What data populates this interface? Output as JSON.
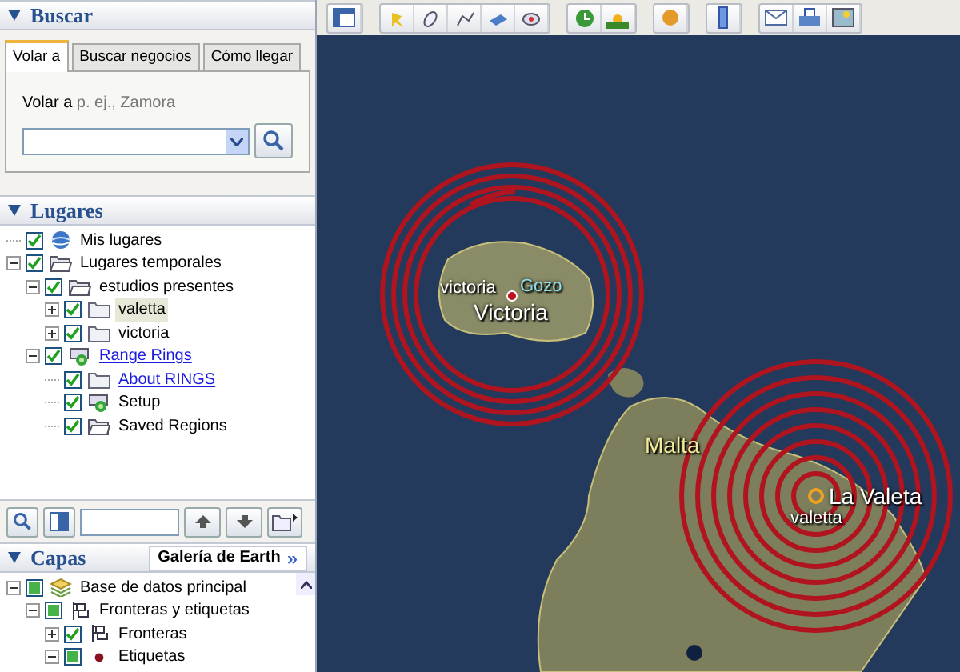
{
  "search": {
    "title": "Buscar",
    "expanded": true,
    "tabs": [
      {
        "label": "Volar a",
        "selected": true
      },
      {
        "label": "Buscar negocios",
        "selected": false
      },
      {
        "label": "Cómo llegar",
        "selected": false
      }
    ],
    "prompt": "Volar a",
    "placeholder": "p. ej., Zamora"
  },
  "places": {
    "title": "Lugares",
    "expanded": true,
    "tree": [
      {
        "label": "Mis lugares",
        "kind": "globe",
        "checked": true,
        "link": false,
        "selected": false
      },
      {
        "label": "Lugares temporales",
        "kind": "folder-open",
        "checked": true,
        "expanded": true,
        "link": false,
        "selected": false,
        "children": [
          {
            "label": "estudios presentes",
            "kind": "folder-open",
            "checked": true,
            "expanded": true,
            "link": false,
            "selected": false,
            "children": [
              {
                "label": "valetta",
                "kind": "folder",
                "checked": true,
                "expanded": false,
                "link": false,
                "selected": true
              },
              {
                "label": "victoria",
                "kind": "folder",
                "checked": true,
                "expanded": false,
                "link": false,
                "selected": false
              }
            ]
          },
          {
            "label": "Range Rings",
            "kind": "rings",
            "checked": true,
            "expanded": true,
            "link": true,
            "selected": false,
            "children": [
              {
                "label": "About RINGS",
                "kind": "folder",
                "checked": true,
                "link": true,
                "selected": false
              },
              {
                "label": "Setup",
                "kind": "rings",
                "checked": true,
                "link": false,
                "selected": false
              },
              {
                "label": "Saved Regions",
                "kind": "folder-open",
                "checked": true,
                "link": false,
                "selected": false
              }
            ]
          }
        ]
      }
    ]
  },
  "layers": {
    "title": "Capas",
    "expanded": true,
    "gallery_button": "Galería de Earth",
    "gallery_arrow": "»",
    "tree": [
      {
        "label": "Base de datos principal",
        "kind": "database",
        "checked": false,
        "partial": true,
        "expanded": true,
        "children": [
          {
            "label": "Fronteras y etiquetas",
            "kind": "flag",
            "checked": false,
            "partial": true,
            "expanded": true,
            "children": [
              {
                "label": "Fronteras",
                "kind": "flag",
                "checked": true,
                "partial": false,
                "expanded": false
              },
              {
                "label": "Etiquetas",
                "kind": "dot",
                "checked": false,
                "partial": true,
                "expanded": true
              }
            ]
          }
        ]
      }
    ]
  },
  "map": {
    "labels": [
      {
        "text": "victoria",
        "kind": "placemark"
      },
      {
        "text": "Gozo",
        "kind": "island"
      },
      {
        "text": "Victoria",
        "kind": "town"
      },
      {
        "text": "Malta",
        "kind": "country"
      },
      {
        "text": "La Valeta",
        "kind": "town"
      },
      {
        "text": "valetta",
        "kind": "placemark"
      }
    ]
  }
}
